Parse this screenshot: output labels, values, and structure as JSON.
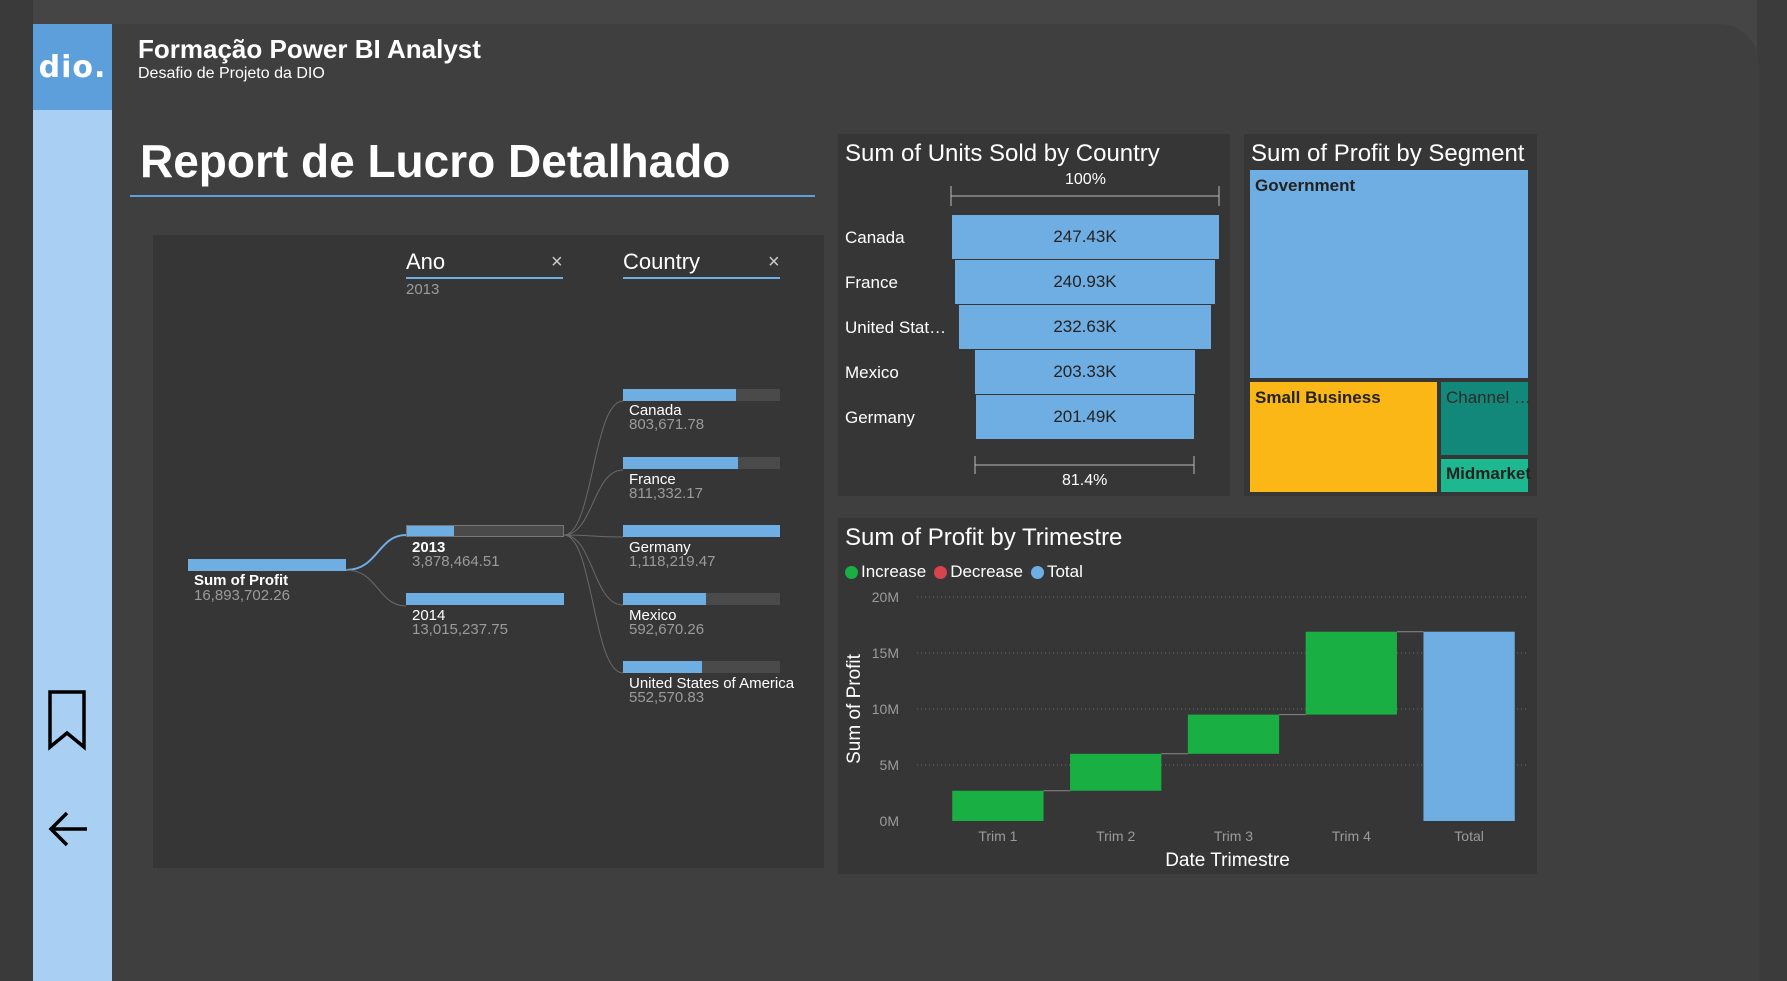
{
  "app": {
    "logo_text": "dio.",
    "title": "Formação Power BI Analyst",
    "subtitle": "Desafio de Projeto da DIO"
  },
  "report": {
    "title": "Report de Lucro Detalhado"
  },
  "sidebar": {
    "icons": [
      "bookmark-icon",
      "back-arrow-icon"
    ]
  },
  "decomposition_tree": {
    "root": {
      "label": "Sum of Profit",
      "value": "16,893,702.26",
      "fill": 1.0
    },
    "levels": [
      {
        "header": "Ano",
        "selected": "2013"
      },
      {
        "header": "Country",
        "selected": ""
      }
    ],
    "years": [
      {
        "label": "2013",
        "value": "3,878,464.51",
        "fill": 0.3,
        "selected": true
      },
      {
        "label": "2014",
        "value": "13,015,237.75",
        "fill": 1.0,
        "selected": false
      }
    ],
    "countries": [
      {
        "label": "Canada",
        "value": "803,671.78",
        "fill": 0.72
      },
      {
        "label": "France",
        "value": "811,332.17",
        "fill": 0.73
      },
      {
        "label": "Germany",
        "value": "1,118,219.47",
        "fill": 1.0
      },
      {
        "label": "Mexico",
        "value": "592,670.26",
        "fill": 0.53
      },
      {
        "label": "United States of America",
        "value": "552,570.83",
        "fill": 0.5
      }
    ]
  },
  "funnel": {
    "title": "Sum of Units Sold by Country",
    "top_pct": "100%",
    "bottom_pct": "81.4%",
    "items": [
      {
        "label": "Canada",
        "display": "247.43K",
        "value": 247430
      },
      {
        "label": "France",
        "display": "240.93K",
        "value": 240930
      },
      {
        "label": "United Stat…",
        "display": "232.63K",
        "value": 232630
      },
      {
        "label": "Mexico",
        "display": "203.33K",
        "value": 203330
      },
      {
        "label": "Germany",
        "display": "201.49K",
        "value": 201490
      }
    ]
  },
  "treemap": {
    "title": "Sum of Profit by Segment",
    "tiles": [
      {
        "label": "Government",
        "color": "#6faee2"
      },
      {
        "label": "Small Business",
        "color": "#fbb716"
      },
      {
        "label": "Channel …",
        "color": "#12887a"
      },
      {
        "label": "Midmarket",
        "color": "#1db88f"
      }
    ]
  },
  "chart_data": {
    "type": "waterfall",
    "title": "Sum of Profit by Trimestre",
    "xlabel": "Date Trimestre",
    "ylabel": "Sum of Profit",
    "ylim": [
      0,
      20000000
    ],
    "yticks": [
      0,
      5000000,
      10000000,
      15000000,
      20000000
    ],
    "ytick_labels": [
      "0M",
      "5M",
      "10M",
      "15M",
      "20M"
    ],
    "legend": [
      {
        "name": "Increase",
        "color": "#1aaf43"
      },
      {
        "name": "Decrease",
        "color": "#d9434f"
      },
      {
        "name": "Total",
        "color": "#6faee2"
      }
    ],
    "categories": [
      "Trim 1",
      "Trim 2",
      "Trim 3",
      "Trim 4",
      "Total"
    ],
    "values": [
      2700000,
      3300000,
      3500000,
      7400000,
      16900000
    ],
    "kinds": [
      "increase",
      "increase",
      "increase",
      "increase",
      "total"
    ]
  }
}
